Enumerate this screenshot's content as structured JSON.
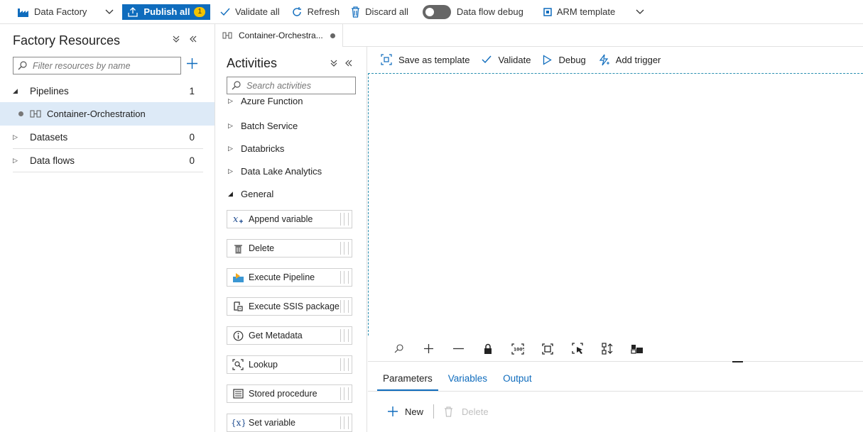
{
  "topbar": {
    "app_name": "Data Factory",
    "publish_label": "Publish all",
    "publish_count": "1",
    "validate_all": "Validate all",
    "refresh": "Refresh",
    "discard_all": "Discard all",
    "dataflow_debug": "Data flow debug",
    "arm_template": "ARM template"
  },
  "resources": {
    "title": "Factory Resources",
    "search_placeholder": "Filter resources by name",
    "pipelines": {
      "label": "Pipelines",
      "count": "1"
    },
    "pipeline_item": "Container-Orchestration",
    "datasets": {
      "label": "Datasets",
      "count": "0"
    },
    "dataflows": {
      "label": "Data flows",
      "count": "0"
    }
  },
  "tab": {
    "label": "Container-Orchestra..."
  },
  "activities": {
    "title": "Activities",
    "search_placeholder": "Search activities",
    "groups": [
      "Azure Function",
      "Batch Service",
      "Databricks",
      "Data Lake Analytics",
      "General"
    ],
    "general_items": [
      "Append variable",
      "Delete",
      "Execute Pipeline",
      "Execute SSIS package",
      "Get Metadata",
      "Lookup",
      "Stored procedure",
      "Set variable"
    ]
  },
  "canvas_toolbar": {
    "save_as_template": "Save as template",
    "validate": "Validate",
    "debug": "Debug",
    "add_trigger": "Add trigger"
  },
  "bottom": {
    "tabs": [
      "Parameters",
      "Variables",
      "Output"
    ],
    "new_label": "New",
    "delete_label": "Delete"
  },
  "colors": {
    "accent": "#0f6cbd",
    "badge": "#f5c400",
    "selected_row": "#ddeaf7"
  }
}
